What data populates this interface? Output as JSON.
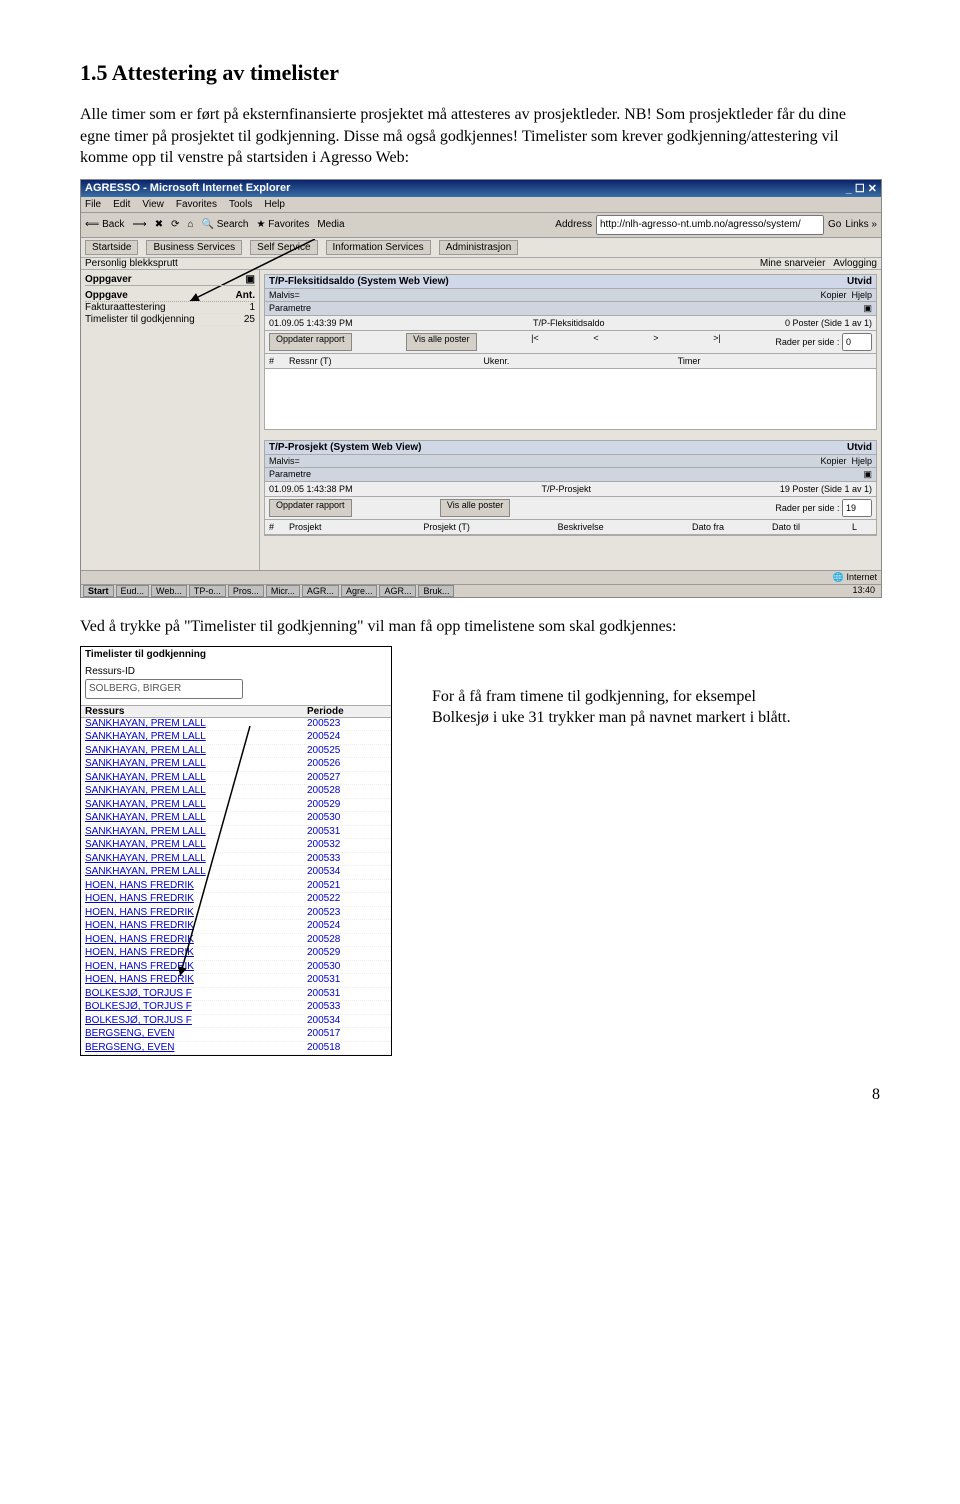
{
  "heading": "1.5  Attestering av timelister",
  "paragraph": "Alle timer som er ført på eksternfinansierte prosjektet må attesteres av prosjektleder. NB! Som prosjektleder får du dine egne timer på prosjektet til godkjenning. Disse må også godkjennes! Timelister som krever godkjenning/attestering vil komme opp til venstre på startsiden i Agresso Web:",
  "caption2": "Ved å trykke på \"Timelister til godkjenning\" vil man få opp timelistene som skal godkjennes:",
  "sidetext": "For å få fram timene til godkjenning, for eksempel Bolkesjø i uke 31 trykker man på navnet markert i blått.",
  "page_number": "8",
  "shot1": {
    "title": "AGRESSO - Microsoft Internet Explorer",
    "menus": [
      "File",
      "Edit",
      "View",
      "Favorites",
      "Tools",
      "Help"
    ],
    "tb_back": "Back",
    "tb_search": "Search",
    "tb_fav": "Favorites",
    "tb_media": "Media",
    "addr_label": "Address",
    "addr_value": "http://nlh-agresso-nt.umb.no/agresso/system/",
    "go": "Go",
    "links": "Links »",
    "tabs": [
      "Startside",
      "Business Services",
      "Self Service",
      "Information Services",
      "Administrasjon"
    ],
    "sidebar": {
      "subtitle_text": "Personlig blekksprutt",
      "panel": "Oppgaver",
      "task_header_name": "Oppgave",
      "task_header_count": "Ant.",
      "tasks": [
        {
          "name": "Fakturaattestering",
          "count": "1"
        },
        {
          "name": "Timelister til godkjenning",
          "count": "25"
        }
      ]
    },
    "right": {
      "snarveier": "Mine snarveier",
      "avlogging": "Avlogging"
    },
    "report1": {
      "title": "T/P-Fleksitidsaldo (System Web View)",
      "utvid": "Utvid",
      "malvis": "Malvis=",
      "kopier": "Kopier",
      "hjelp": "Hjelp",
      "param": "Parametre",
      "ts": "01.09.05 1:43:39 PM",
      "mid": "T/P-Fleksitidsaldo",
      "status": "0 Poster (Side 1 av 1)",
      "btn1": "Oppdater rapport",
      "btn2": "Vis alle poster",
      "rader": "Rader per side :",
      "rader_val": "0",
      "c0": "#",
      "c1": "Ressnr (T)",
      "c2": "Ukenr.",
      "c3": "Timer"
    },
    "report2": {
      "title": "T/P-Prosjekt (System Web View)",
      "utvid": "Utvid",
      "malvis": "Malvis=",
      "kopier": "Kopier",
      "hjelp": "Hjelp",
      "param": "Parametre",
      "ts": "01.09.05 1:43:38 PM",
      "mid": "T/P-Prosjekt",
      "status": "19 Poster (Side 1 av 1)",
      "btn1": "Oppdater rapport",
      "btn2": "Vis alle poster",
      "rader": "Rader per side :",
      "rader_val": "19",
      "c0": "#",
      "c1": "Prosjekt",
      "c2": "Prosjekt (T)",
      "c3": "Beskrivelse",
      "c4": "Dato fra",
      "c5": "Dato til",
      "c6": "L"
    },
    "taskbar": {
      "start": "Start",
      "items": [
        "Eud...",
        "Web...",
        "TP-o...",
        "Pros...",
        "Micr...",
        "AGR...",
        "Agre...",
        "AGR...",
        "Bruk..."
      ],
      "clock": "13:40"
    },
    "statusbar_internet": "Internet"
  },
  "shot2": {
    "title": "Timelister til godkjenning",
    "field_label": "Ressurs-ID",
    "field_value": "SOLBERG, BIRGER",
    "col1": "Ressurs",
    "col2": "Periode",
    "rows": [
      {
        "r": "SANKHAYAN, PREM LALL",
        "p": "200523"
      },
      {
        "r": "SANKHAYAN, PREM LALL",
        "p": "200524"
      },
      {
        "r": "SANKHAYAN, PREM LALL",
        "p": "200525"
      },
      {
        "r": "SANKHAYAN, PREM LALL",
        "p": "200526"
      },
      {
        "r": "SANKHAYAN, PREM LALL",
        "p": "200527"
      },
      {
        "r": "SANKHAYAN, PREM LALL",
        "p": "200528"
      },
      {
        "r": "SANKHAYAN, PREM LALL",
        "p": "200529"
      },
      {
        "r": "SANKHAYAN, PREM LALL",
        "p": "200530"
      },
      {
        "r": "SANKHAYAN, PREM LALL",
        "p": "200531"
      },
      {
        "r": "SANKHAYAN, PREM LALL",
        "p": "200532"
      },
      {
        "r": "SANKHAYAN, PREM LALL",
        "p": "200533"
      },
      {
        "r": "SANKHAYAN, PREM LALL",
        "p": "200534"
      },
      {
        "r": "HOEN, HANS FREDRIK",
        "p": "200521"
      },
      {
        "r": "HOEN, HANS FREDRIK",
        "p": "200522"
      },
      {
        "r": "HOEN, HANS FREDRIK",
        "p": "200523"
      },
      {
        "r": "HOEN, HANS FREDRIK",
        "p": "200524"
      },
      {
        "r": "HOEN, HANS FREDRIK",
        "p": "200528"
      },
      {
        "r": "HOEN, HANS FREDRIK",
        "p": "200529"
      },
      {
        "r": "HOEN, HANS FREDRIK",
        "p": "200530"
      },
      {
        "r": "HOEN, HANS FREDRIK",
        "p": "200531"
      },
      {
        "r": "BOLKESJØ, TORJUS F",
        "p": "200531"
      },
      {
        "r": "BOLKESJØ, TORJUS F",
        "p": "200533"
      },
      {
        "r": "BOLKESJØ, TORJUS F",
        "p": "200534"
      },
      {
        "r": "BERGSENG, EVEN",
        "p": "200517"
      },
      {
        "r": "BERGSENG, EVEN",
        "p": "200518"
      }
    ]
  }
}
